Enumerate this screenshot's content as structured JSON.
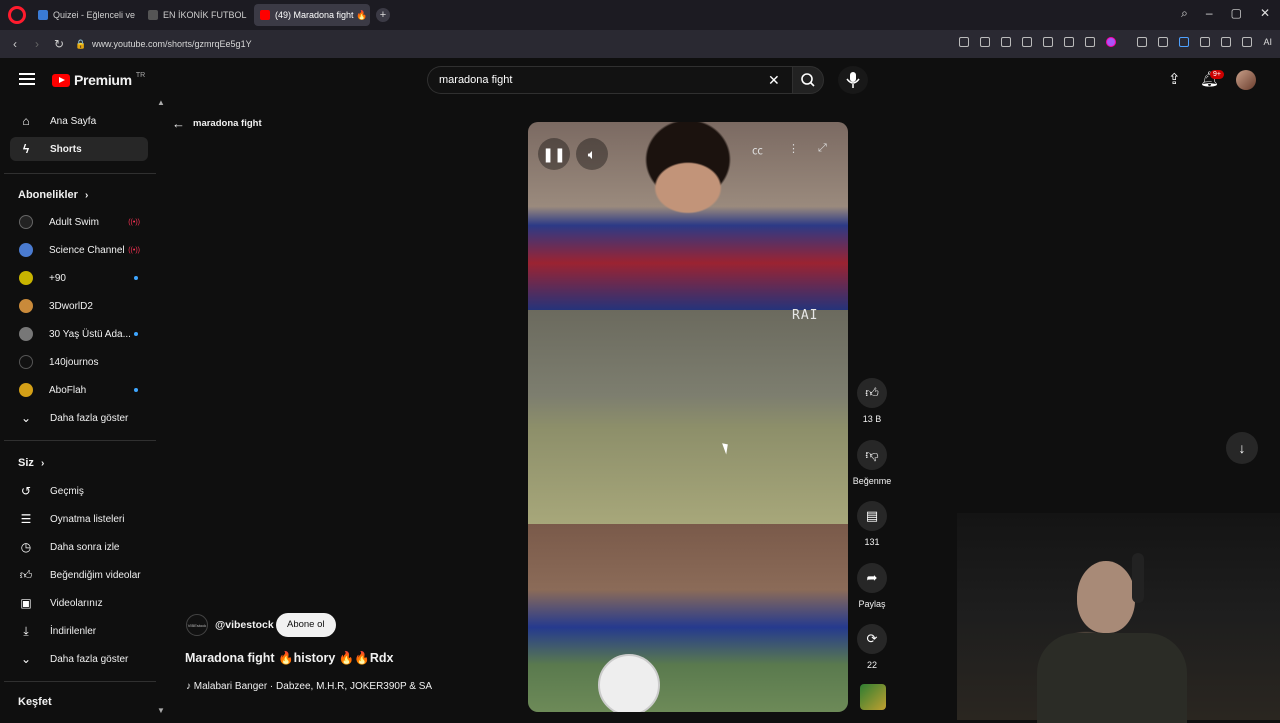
{
  "browser": {
    "tabs": [
      {
        "label": "Quizei - Eğlenceli ve etkile",
        "fav_color": "#3a7bd5",
        "active": false
      },
      {
        "label": "EN İKONİK FUTBOL İNTİK",
        "fav_color": "#333333",
        "active": false
      },
      {
        "label": "(49) Maradona fight 🔥",
        "fav_color": "#ff0000",
        "active": true
      }
    ],
    "url": "www.youtube.com/shorts/gzmrqEe5g1Y",
    "ai_label": "AI"
  },
  "header": {
    "logo_text": "Premium",
    "logo_region": "TR",
    "search_value": "maradona fight",
    "notification_count": "9+"
  },
  "sidebar": {
    "main_items": [
      {
        "label": "Ana Sayfa",
        "icon": "home-icon"
      },
      {
        "label": "Shorts",
        "icon": "shorts-icon",
        "active": true
      }
    ],
    "subscriptions_title": "Abonelikler",
    "subscriptions": [
      {
        "label": "Adult Swim",
        "avatar_color": "#222222",
        "indicator": "live"
      },
      {
        "label": "Science Channel",
        "avatar_color": "#4a7bd0",
        "indicator": "live"
      },
      {
        "label": "+90",
        "avatar_color": "#c8b400",
        "indicator": "dot"
      },
      {
        "label": "3DworlD2",
        "avatar_color": "#c98a3a",
        "indicator": ""
      },
      {
        "label": "30 Yaş Üstü Ada...",
        "avatar_color": "#777777",
        "indicator": "dot"
      },
      {
        "label": "140journos",
        "avatar_color": "#111111",
        "indicator": ""
      },
      {
        "label": "AboFlah",
        "avatar_color": "#d4a017",
        "indicator": "dot"
      }
    ],
    "subs_more": "Daha fazla göster",
    "you_title": "Siz",
    "you_items": [
      {
        "label": "Geçmiş",
        "icon": "history-icon"
      },
      {
        "label": "Oynatma listeleri",
        "icon": "playlist-icon"
      },
      {
        "label": "Daha sonra izle",
        "icon": "clock-icon"
      },
      {
        "label": "Beğendiğim videolar",
        "icon": "thumbs-up-icon"
      },
      {
        "label": "Videolarınız",
        "icon": "video-icon"
      },
      {
        "label": "İndirilenler",
        "icon": "download-icon"
      }
    ],
    "you_more": "Daha fazla göster",
    "explore_title": "Keşfet"
  },
  "main": {
    "back_label": "maradona fight",
    "watermark": "RAI",
    "channel_handle": "@vibestock",
    "channel_avatar_text": "VIBEstock",
    "subscribe_label": "Abone ol",
    "video_title": "Maradona fight 🔥history 🔥🔥Rdx",
    "music": "♪ Malabari Banger · Dabzee, M.H.R, JOKER390P & SA",
    "actions": {
      "likes": "13 B",
      "dislike_label": "Beğenme",
      "comments": "131",
      "share_label": "Paylaş",
      "remix_count": "22"
    }
  }
}
